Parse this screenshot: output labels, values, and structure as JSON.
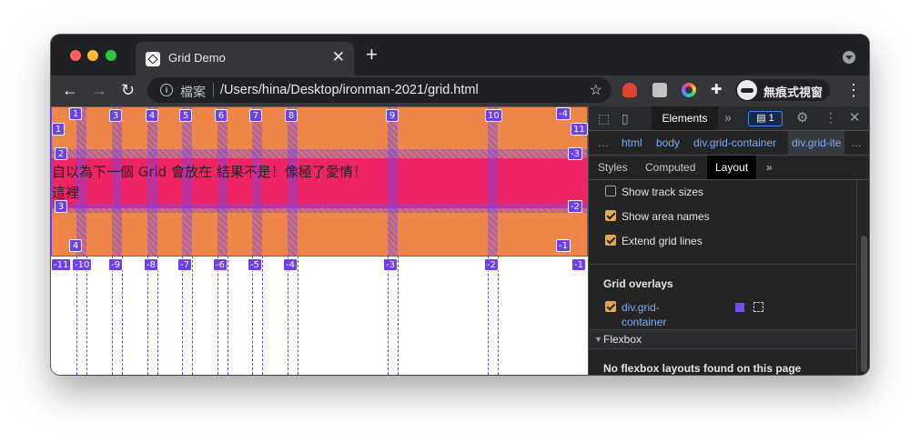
{
  "browser": {
    "tab": {
      "title": "Grid Demo",
      "favicon": "codepen-favicon",
      "close": "✕"
    },
    "new_tab": "+",
    "toolbar": {
      "back": "←",
      "forward": "→",
      "reload": "↻",
      "security_label": "檔案",
      "url": "/Users/hina/Desktop/ironman-2021/grid.html",
      "star": "☆",
      "incognito_label": "無痕式視窗",
      "menu": "⋮"
    },
    "extensions": [
      "red-extension-icon",
      "gray-extension-icon",
      "color-picker-extension-icon",
      "puzzle-icon"
    ]
  },
  "page": {
    "item_text_line1": "自以為下一個 Grid 會放在",
    "item_text_line2": "結果不是！像極了愛情！",
    "item_text_line3": "這裡",
    "colors": {
      "grid_background": "#ee8549",
      "item_background": "#ee2465",
      "overlay": "#6e3ff0"
    },
    "line_numbers_top": [
      "1",
      "3",
      "4",
      "5",
      "6",
      "7",
      "8",
      "9",
      "10",
      "-4"
    ],
    "line_numbers_bottom": [
      "-11",
      "-10",
      "-9",
      "-8",
      "-7",
      "-6",
      "-5",
      "-4",
      "-3",
      "-2",
      "-1"
    ],
    "row_numbers_left": [
      "1",
      "2",
      "3",
      "4"
    ],
    "row_numbers_right": [
      "11",
      "-3",
      "-2",
      "-1"
    ]
  },
  "devtools": {
    "top_tabs": {
      "elements": "Elements",
      "more": "»",
      "messages": "1"
    },
    "breadcrumbs": [
      "html",
      "body",
      "div.grid-container",
      "div.grid-ite"
    ],
    "breadcrumb_ellipsis": "…",
    "subtabs": [
      "Styles",
      "Computed",
      "Layout"
    ],
    "subtabs_more": "»",
    "layout": {
      "options": [
        {
          "label": "Show track sizes",
          "checked": false
        },
        {
          "label": "Show area names",
          "checked": true
        },
        {
          "label": "Extend grid lines",
          "checked": true
        }
      ],
      "overlays_heading": "Grid overlays",
      "overlay_item": {
        "label": "div.grid-container",
        "checked": true,
        "color": "#7b4df0"
      },
      "flexbox_heading": "Flexbox",
      "flexbox_empty": "No flexbox layouts found on this page"
    }
  }
}
